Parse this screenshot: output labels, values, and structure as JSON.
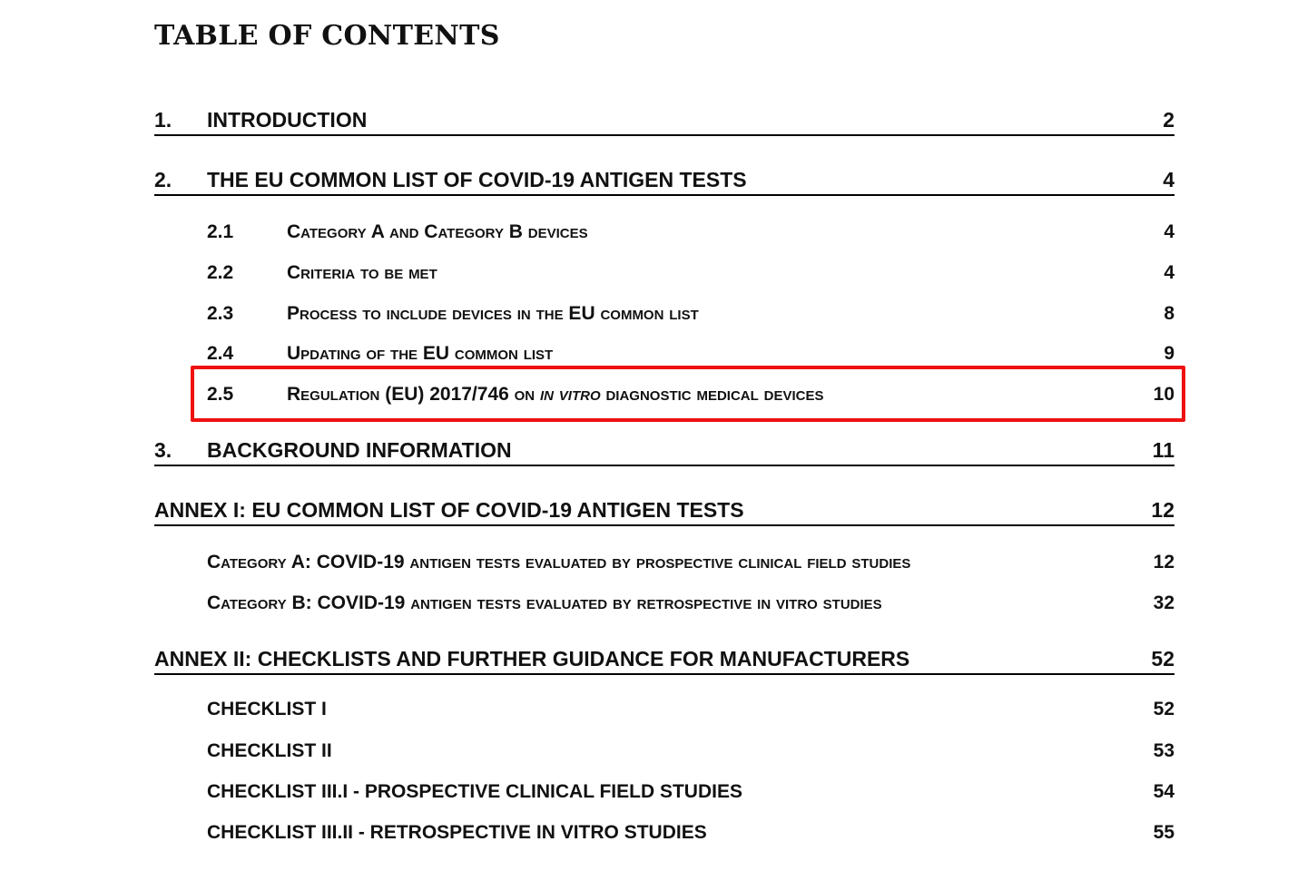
{
  "title": "TABLE OF CONTENTS",
  "entries": [
    {
      "num": "1.",
      "text": "INTRODUCTION",
      "page": "2"
    },
    {
      "num": "2.",
      "text": "THE EU COMMON LIST OF COVID-19 ANTIGEN TESTS",
      "page": "4"
    },
    {
      "num": "2.1",
      "text": "Category A and Category B devices",
      "page": "4"
    },
    {
      "num": "2.2",
      "text": "Criteria to be met",
      "page": "4"
    },
    {
      "num": "2.3",
      "text": "Process to include devices in the EU common list",
      "page": "8"
    },
    {
      "num": "2.4",
      "text": "Updating of the EU common list",
      "page": "9"
    },
    {
      "num": "2.5",
      "text_before": "Regulation (EU) 2017/746 on ",
      "text_italic": "in vitro",
      "text_after": " diagnostic medical devices",
      "page": "10"
    },
    {
      "num": "3.",
      "text": "BACKGROUND INFORMATION",
      "page": "11"
    },
    {
      "text": "ANNEX I: EU COMMON LIST OF COVID-19 ANTIGEN TESTS",
      "page": "12"
    },
    {
      "text": "Category A: COVID-19 antigen tests evaluated by prospective clinical field studies",
      "page": "12"
    },
    {
      "text": "Category B: COVID-19 antigen tests evaluated by retrospective in vitro studies",
      "page": "32"
    },
    {
      "text": "ANNEX II: CHECKLISTS AND FURTHER GUIDANCE FOR MANUFACTURERS",
      "page": "52"
    },
    {
      "text": "Checklist I",
      "page": "52"
    },
    {
      "text": "Checklist II",
      "page": "53"
    },
    {
      "text": "Checklist III.I - Prospective clinical field studies",
      "page": "54"
    },
    {
      "text": "Checklist III.II - Retrospective in vitro studies",
      "page": "55"
    }
  ],
  "highlight_color": "#ee1111"
}
